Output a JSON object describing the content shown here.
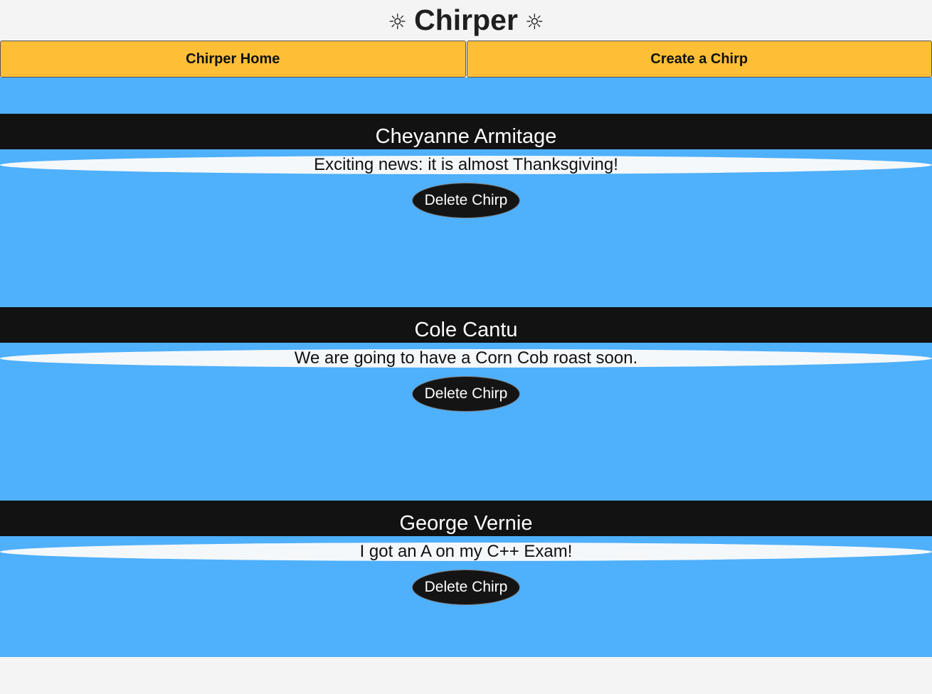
{
  "header": {
    "title": "Chirper",
    "left_icon": "☼",
    "right_icon": "☼"
  },
  "nav": {
    "home_label": "Chirper Home",
    "create_label": "Create a Chirp"
  },
  "colors": {
    "nav_button": "#febf37",
    "feed_background": "#4fb0fb",
    "author_bar": "#121212",
    "message_pill": "#f5f8fa",
    "delete_button": "#141414"
  },
  "chirps": [
    {
      "author": "Cheyanne Armitage",
      "message": "Exciting news: it is almost Thanksgiving!",
      "delete_label": "Delete Chirp"
    },
    {
      "author": "Cole Cantu",
      "message": "We are going to have a Corn Cob roast soon.",
      "delete_label": "Delete Chirp"
    },
    {
      "author": "George Vernie",
      "message": "I got an A on my C++ Exam!",
      "delete_label": "Delete Chirp"
    }
  ]
}
